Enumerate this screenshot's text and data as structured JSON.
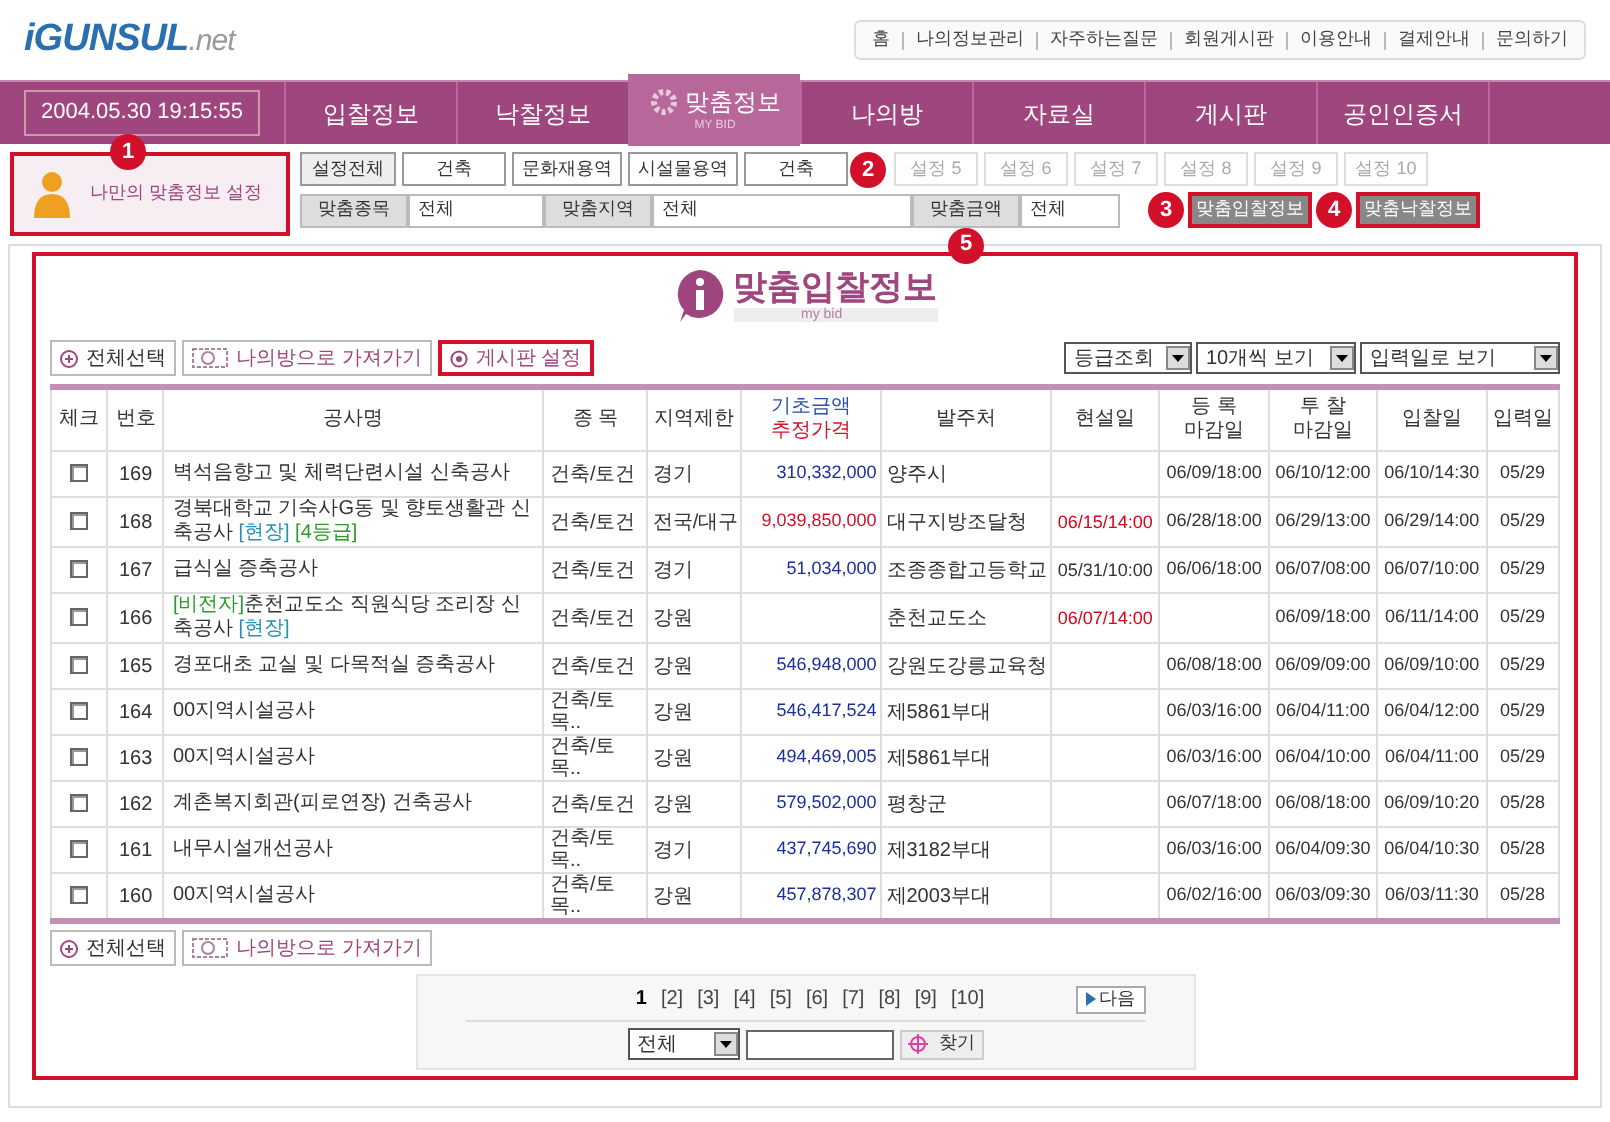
{
  "logo": {
    "main": "iGUNSUL",
    "suffix": ".net"
  },
  "top_links": [
    "홈",
    "나의정보관리",
    "자주하는질문",
    "회원게시판",
    "이용안내",
    "결제안내",
    "문의하기"
  ],
  "datetime": "2004.05.30 19:15:55",
  "nav_tabs": [
    {
      "label": "입찰정보",
      "selected": false
    },
    {
      "label": "낙찰정보",
      "selected": false
    },
    {
      "label": "맞춤정보",
      "sub": "MY BID",
      "selected": true
    },
    {
      "label": "나의방",
      "selected": false
    },
    {
      "label": "자료실",
      "selected": false
    },
    {
      "label": "게시판",
      "selected": false
    },
    {
      "label": "공인인증서",
      "selected": false
    }
  ],
  "my_settings": {
    "label": "나만의 맞춤정보 설정",
    "callout": "1"
  },
  "setting_slots": [
    {
      "kind": "all",
      "label": "설정전체"
    },
    {
      "kind": "filled",
      "label": "건축"
    },
    {
      "kind": "filled",
      "label": "문화재용역"
    },
    {
      "kind": "filled",
      "label": "시설물용역"
    },
    {
      "kind": "filled",
      "label": "건축",
      "callout": "2"
    },
    {
      "kind": "empty",
      "label": "설정 5"
    },
    {
      "kind": "empty",
      "label": "설정 6"
    },
    {
      "kind": "empty",
      "label": "설정 7"
    },
    {
      "kind": "empty",
      "label": "설정 8"
    },
    {
      "kind": "empty",
      "label": "설정 9"
    },
    {
      "kind": "empty",
      "label": "설정 10"
    }
  ],
  "filters": [
    {
      "label": "맞춤종목",
      "value": "전체"
    },
    {
      "label": "맞춤지역",
      "value": "전체"
    },
    {
      "label": "맞춤금액",
      "value": "전체",
      "callout": "5"
    }
  ],
  "view_buttons": [
    {
      "label": "맞춤입찰정보",
      "callout": "3"
    },
    {
      "label": "맞춤낙찰정보",
      "callout": "4"
    }
  ],
  "section": {
    "title": "맞춤입찰정보",
    "subtitle": "my bid"
  },
  "toolbar": [
    {
      "kind": "select_all",
      "label": "전체선택",
      "highlighted": false
    },
    {
      "kind": "move",
      "label": "나의방으로 가져가기",
      "highlighted": false
    },
    {
      "kind": "settings",
      "label": "게시판 설정",
      "highlighted": true
    }
  ],
  "view_selects": [
    "등급조회",
    "10개씩 보기",
    "입력일로 보기"
  ],
  "table": {
    "columns": [
      {
        "label": "체크"
      },
      {
        "label": "번호"
      },
      {
        "label": "공사명"
      },
      {
        "label": "종 목"
      },
      {
        "label": "지역제한"
      },
      {
        "label": "기초금액",
        "label2": "추정가격"
      },
      {
        "label": "발주처"
      },
      {
        "label": "현설일"
      },
      {
        "label": "등 록",
        "label2": "마감일"
      },
      {
        "label": "투 찰",
        "label2": "마감일"
      },
      {
        "label": "입찰일"
      },
      {
        "label": "입력일"
      }
    ],
    "rows": [
      {
        "checked": false,
        "no": "169",
        "name": "벽석음향고 및 체력단련시설 신축공사",
        "tags": [],
        "type": "건축/토건",
        "region": "경기",
        "amount": "310,332,000",
        "estimated": false,
        "client": "양주시",
        "site": "",
        "reg": "06/09/18:00",
        "bid_close": "06/10/12:00",
        "bid": "06/10/14:30",
        "input": "05/29"
      },
      {
        "checked": false,
        "no": "168",
        "name": "경북대학교 기숙사G동 및 향토생활관 신축공사",
        "tags": [
          {
            "text": "[현장]",
            "color": "#2a8fb8"
          },
          {
            "text": "[4등급]",
            "color": "#2a9a2a"
          }
        ],
        "type": "건축/토건",
        "region": "전국/대구",
        "amount": "9,039,850,000",
        "estimated": true,
        "client": "대구지방조달청",
        "site": "06/15/14:00",
        "urgent": true,
        "reg": "06/28/18:00",
        "bid_close": "06/29/13:00",
        "bid": "06/29/14:00",
        "input": "05/29"
      },
      {
        "checked": false,
        "no": "167",
        "name": "급식실 증축공사",
        "tags": [],
        "type": "건축/토건",
        "region": "경기",
        "amount": "51,034,000",
        "estimated": false,
        "client": "조종종합고등학교",
        "site": "05/31/10:00",
        "urgent": false,
        "reg": "06/06/18:00",
        "bid_close": "06/07/08:00",
        "bid": "06/07/10:00",
        "input": "05/29"
      },
      {
        "checked": false,
        "no": "166",
        "prefix": "[비전자]",
        "name": "춘천교도소 직원식당 조리장 신축공사",
        "tags": [
          {
            "text": "[현장]",
            "color": "#2a8fb8"
          }
        ],
        "type": "건축/토건",
        "region": "강원",
        "amount": "",
        "client": "춘천교도소",
        "site": "06/07/14:00",
        "urgent": true,
        "reg": "",
        "bid_close": "06/09/18:00",
        "bid": "06/11/14:00",
        "input": "05/29"
      },
      {
        "checked": false,
        "no": "165",
        "name": "경포대초 교실 및 다목적실 증축공사",
        "tags": [],
        "type": "건축/토건",
        "region": "강원",
        "amount": "546,948,000",
        "estimated": false,
        "client": "강원도강릉교육청",
        "site": "",
        "reg": "06/08/18:00",
        "bid_close": "06/09/09:00",
        "bid": "06/09/10:00",
        "input": "05/29"
      },
      {
        "checked": false,
        "no": "164",
        "name": "00지역시설공사",
        "tags": [],
        "type": "건축/토목..",
        "region": "강원",
        "amount": "546,417,524",
        "estimated": false,
        "client": "제5861부대",
        "site": "",
        "reg": "06/03/16:00",
        "bid_close": "06/04/11:00",
        "bid": "06/04/12:00",
        "input": "05/29"
      },
      {
        "checked": false,
        "no": "163",
        "name": "00지역시설공사",
        "tags": [],
        "type": "건축/토목..",
        "region": "강원",
        "amount": "494,469,005",
        "estimated": false,
        "client": "제5861부대",
        "site": "",
        "reg": "06/03/16:00",
        "bid_close": "06/04/10:00",
        "bid": "06/04/11:00",
        "input": "05/29"
      },
      {
        "checked": false,
        "no": "162",
        "name": "계촌복지회관(피로연장) 건축공사",
        "tags": [],
        "type": "건축/토건",
        "region": "강원",
        "amount": "579,502,000",
        "estimated": false,
        "client": "평창군",
        "site": "",
        "reg": "06/07/18:00",
        "bid_close": "06/08/18:00",
        "bid": "06/09/10:20",
        "input": "05/28"
      },
      {
        "checked": false,
        "no": "161",
        "name": "내무시설개선공사",
        "tags": [],
        "type": "건축/토목..",
        "region": "경기",
        "amount": "437,745,690",
        "estimated": false,
        "client": "제3182부대",
        "site": "",
        "reg": "06/03/16:00",
        "bid_close": "06/04/09:30",
        "bid": "06/04/10:30",
        "input": "05/28"
      },
      {
        "checked": false,
        "no": "160",
        "name": "00지역시설공사",
        "tags": [],
        "type": "건축/토목..",
        "region": "강원",
        "amount": "457,878,307",
        "estimated": false,
        "client": "제2003부대",
        "site": "",
        "reg": "06/02/16:00",
        "bid_close": "06/03/09:30",
        "bid": "06/03/11:30",
        "input": "05/28"
      }
    ]
  },
  "bottom_toolbar": [
    {
      "kind": "select_all",
      "label": "전체선택",
      "highlighted": false
    },
    {
      "kind": "move",
      "label": "나의방으로 가져가기",
      "highlighted": false
    }
  ],
  "pagination": {
    "pages": [
      {
        "label": "1",
        "selected": true
      },
      {
        "label": "[2]",
        "selected": false
      },
      {
        "label": "[3]",
        "selected": false
      },
      {
        "label": "[4]",
        "selected": false
      },
      {
        "label": "[5]",
        "selected": false
      },
      {
        "label": "[6]",
        "selected": false
      },
      {
        "label": "[7]",
        "selected": false
      },
      {
        "label": "[8]",
        "selected": false
      },
      {
        "label": "[9]",
        "selected": false
      },
      {
        "label": "[10]",
        "selected": false
      }
    ],
    "next": "다음"
  },
  "search": {
    "scope": "전체",
    "button": "찾기"
  }
}
